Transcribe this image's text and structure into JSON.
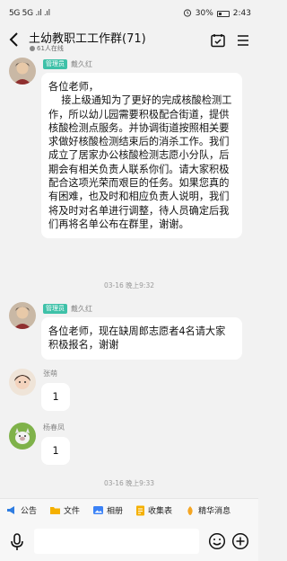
{
  "status_bar": {
    "left_indicators": "5G 5G .ıl .ıl",
    "battery": "30%",
    "time": "2:43"
  },
  "header": {
    "title": "土幼教职工工作群(71)",
    "online": "61人在线"
  },
  "messages": [
    {
      "badge": "管理员",
      "sender": "戴久红",
      "text": "各位老师，\n    接上级通知为了更好的完成核酸检测工作，所以幼儿园需要积极配合街道，提供核酸检测点服务。并协调街道按照相关要求做好核酸检测结束后的消杀工作。我们成立了居家办公核酸检测志愿小分队，后期会有相关负责人联系你们。请大家积极配合这项光荣而艰巨的任务。如果您真的有困难，也及时和相应负责人说明，我们将及时对名单进行调整，待人员确定后我们再将名单公布在群里，谢谢。"
    },
    {
      "badge": "管理员",
      "sender": "戴久红",
      "text": "各位老师，现在缺周郎志愿者4名请大家积极报名，谢谢"
    },
    {
      "sender": "张萌",
      "text": "1"
    },
    {
      "sender": "杨春凤",
      "text": "1"
    }
  ],
  "timestamps": [
    "03-16 晚上9:32",
    "03-16 晚上9:33"
  ],
  "toolbar": {
    "items": [
      {
        "label": "公告",
        "icon": "announcement-icon",
        "color": "#2f7de1"
      },
      {
        "label": "文件",
        "icon": "folder-icon",
        "color": "#f5b000"
      },
      {
        "label": "相册",
        "icon": "album-icon",
        "color": "#3b82f6"
      },
      {
        "label": "收集表",
        "icon": "form-icon",
        "color": "#f5b000"
      },
      {
        "label": "精华消息",
        "icon": "essence-icon",
        "color": "#f5a623"
      }
    ]
  },
  "colors": {
    "admin_badge": "#3ec1a8",
    "background": "#f2f2f2"
  }
}
